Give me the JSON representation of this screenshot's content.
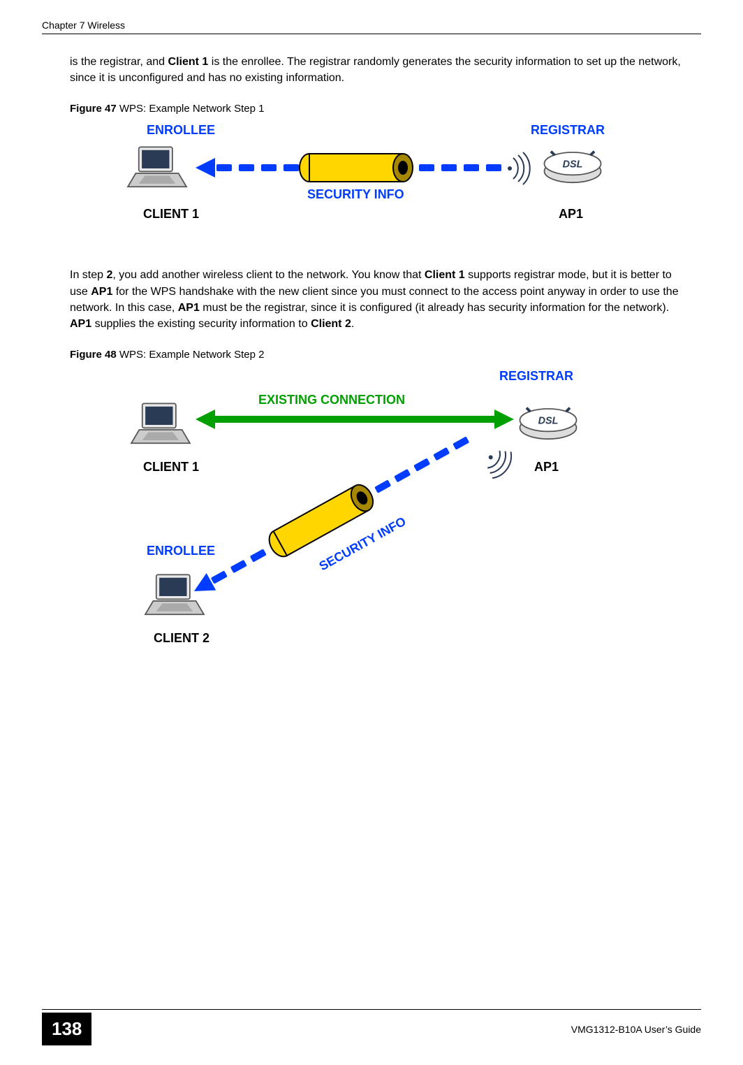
{
  "header": {
    "chapter": "Chapter 7 Wireless"
  },
  "para1_pre": "is the registrar, and ",
  "para1_client1": "Client 1",
  "para1_post": " is the enrollee. The registrar randomly generates the security information to set up the network, since it is unconfigured and has no existing information.",
  "fig47": {
    "label_bold": "Figure 47",
    "label_rest": "   WPS: Example Network Step 1",
    "enrollee": "ENROLLEE",
    "registrar": "REGISTRAR",
    "security": "SECURITY INFO",
    "client1": "CLIENT 1",
    "ap1": "AP1"
  },
  "para2_a": "In step ",
  "para2_step": "2",
  "para2_b": ", you add another wireless client to the network. You know that ",
  "para2_client1": "Client 1",
  "para2_c": " supports registrar mode, but it is better to use ",
  "para2_ap1a": "AP1",
  "para2_d": " for the WPS handshake with the new client since you must connect to the access point anyway in order to use the network. In this case, ",
  "para2_ap1b": "AP1",
  "para2_e": " must be the registrar, since it is configured (it already has security information for the network). ",
  "para2_ap1c": "AP1",
  "para2_f": " supplies the existing security information to ",
  "para2_client2": "Client 2",
  "para2_g": ".",
  "fig48": {
    "label_bold": "Figure 48",
    "label_rest": "   WPS: Example Network Step 2",
    "registrar": "REGISTRAR",
    "existing": "EXISTING CONNECTION",
    "client1": "CLIENT 1",
    "ap1": "AP1",
    "enrollee": "ENROLLEE",
    "security": "SECURITY INFO",
    "client2": "CLIENT 2"
  },
  "footer": {
    "page": "138",
    "guide": "VMG1312-B10A User’s Guide"
  }
}
